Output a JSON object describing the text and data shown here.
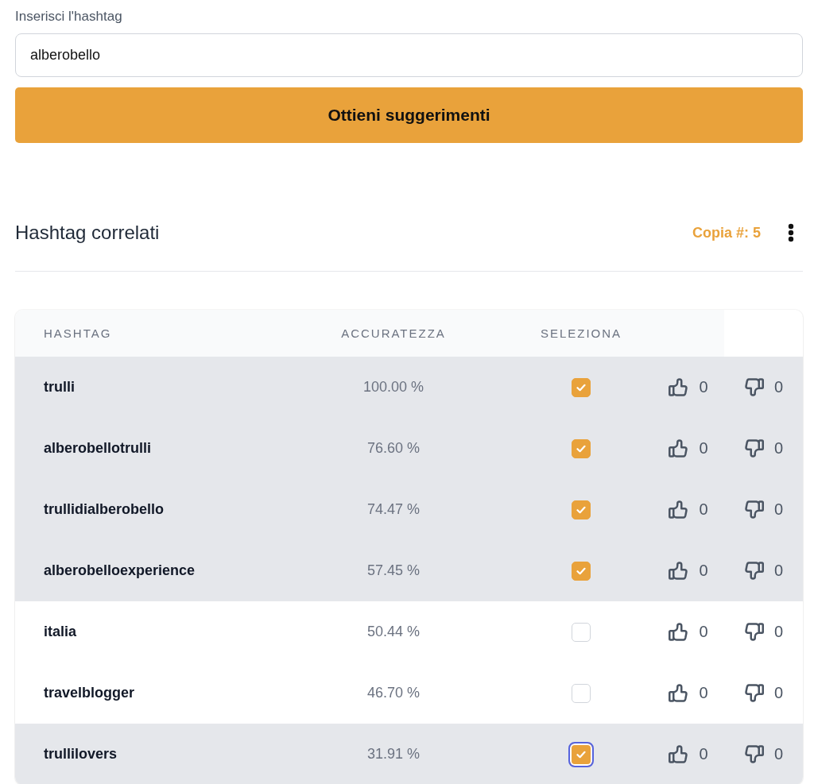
{
  "form": {
    "label": "Inserisci l'hashtag",
    "input": {
      "value": "alberobello"
    },
    "button": "Ottieni suggerimenti"
  },
  "results": {
    "title": "Hashtag correlati",
    "copy_button": "Copia #: 5"
  },
  "table": {
    "columns": [
      "HASHTAG",
      "ACCURATEZZA",
      "SELEZIONA"
    ],
    "rows": [
      {
        "hashtag": "trulli",
        "accuracy": "100.00 %",
        "checked": true,
        "focused": false,
        "likes": "0",
        "dislikes": "0"
      },
      {
        "hashtag": "alberobellotrulli",
        "accuracy": "76.60 %",
        "checked": true,
        "focused": false,
        "likes": "0",
        "dislikes": "0"
      },
      {
        "hashtag": "trullidialberobello",
        "accuracy": "74.47 %",
        "checked": true,
        "focused": false,
        "likes": "0",
        "dislikes": "0"
      },
      {
        "hashtag": "alberobelloexperience",
        "accuracy": "57.45 %",
        "checked": true,
        "focused": false,
        "likes": "0",
        "dislikes": "0"
      },
      {
        "hashtag": "italia",
        "accuracy": "50.44 %",
        "checked": false,
        "focused": false,
        "likes": "0",
        "dislikes": "0"
      },
      {
        "hashtag": "travelblogger",
        "accuracy": "46.70 %",
        "checked": false,
        "focused": false,
        "likes": "0",
        "dislikes": "0"
      },
      {
        "hashtag": "trullilovers",
        "accuracy": "31.91 %",
        "checked": true,
        "focused": true,
        "likes": "0",
        "dislikes": "0"
      }
    ]
  }
}
